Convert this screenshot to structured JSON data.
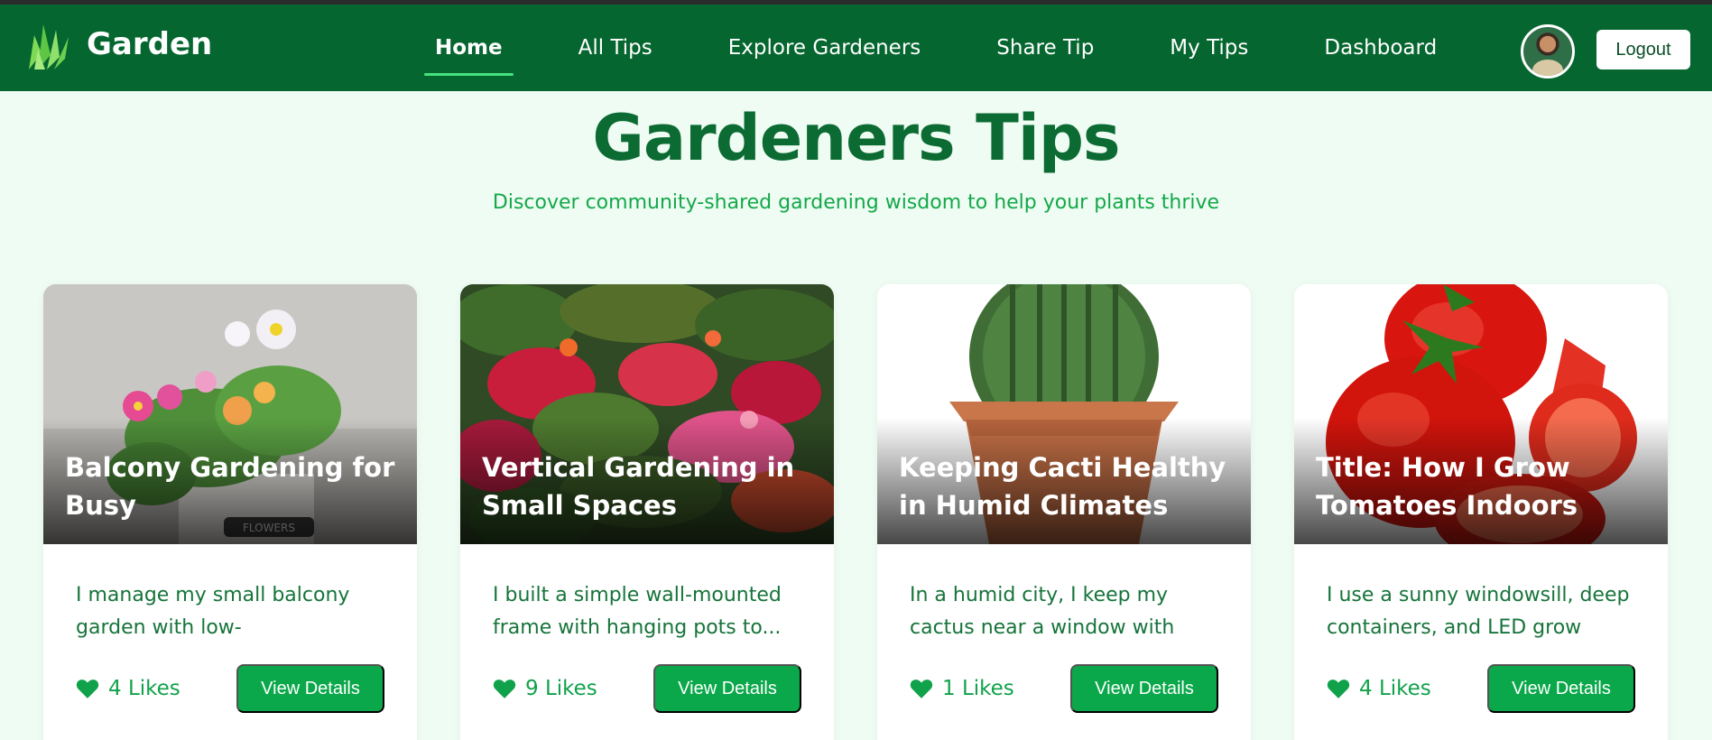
{
  "brand": {
    "name": "Garden",
    "logo_icon": "grass-icon"
  },
  "nav": {
    "links": [
      {
        "label": "Home",
        "active": true
      },
      {
        "label": "All Tips"
      },
      {
        "label": "Explore Gardeners"
      },
      {
        "label": "Share Tip"
      },
      {
        "label": "My Tips"
      },
      {
        "label": "Dashboard"
      }
    ],
    "logout_label": "Logout"
  },
  "hero": {
    "title": "Gardeners Tips",
    "subtitle": "Discover community-shared gardening wisdom to help your plants thrive"
  },
  "cards": [
    {
      "title": "Balcony Gardening for Busy",
      "desc_line1": "I manage my small balcony",
      "desc_line2": "garden with low-maintenance...",
      "likes": "4 Likes",
      "button": "View Details",
      "image": "balcony-flowers-photo"
    },
    {
      "title": "Vertical Gardening in Small Spaces",
      "desc_line1": "I built a simple wall-mounted",
      "desc_line2": "frame with hanging pots to...",
      "likes": "9 Likes",
      "button": "View Details",
      "image": "vertical-garden-photo"
    },
    {
      "title": "Keeping Cacti Healthy in Humid Climates",
      "desc_line1": "In a humid city, I keep my",
      "desc_line2": "cactus near a window with go...",
      "likes": "1 Likes",
      "button": "View Details",
      "image": "cactus-pot-photo"
    },
    {
      "title": "Title: How I Grow Tomatoes Indoors",
      "desc_line1": "I use a sunny windowsill, deep",
      "desc_line2": "containers, and LED grow light...",
      "likes": "4 Likes",
      "button": "View Details",
      "image": "tomatoes-photo"
    }
  ],
  "colors": {
    "nav_bg": "#05662f",
    "page_bg": "#effcf3",
    "accent": "#0aa84a",
    "title": "#0b6b32"
  }
}
